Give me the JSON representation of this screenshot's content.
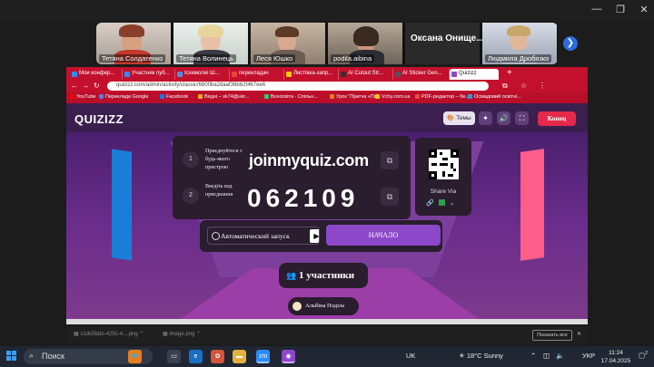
{
  "participants": [
    {
      "name": "Тетяна Солдатенко",
      "active": false
    },
    {
      "name": "Тетяна Волинець",
      "active": true
    },
    {
      "name": "Леся Юшко",
      "active": false
    },
    {
      "name": "podila.aibina",
      "active": false
    },
    {
      "name": "Оксана Онищенко",
      "display": "Оксана Онище..."
    },
    {
      "name": "Людмила Дробязко",
      "active": false
    }
  ],
  "browser": {
    "tabs": [
      "Мои конфер...",
      "Участник пуб...",
      "Ісхемолеі Ш...",
      "перекладач",
      "Листівка-запр...",
      "AI Cutout Str...",
      "AI Sticker Gen...",
      "Quizizz"
    ],
    "url": "quizizz.com/admin/activity/classic/6800ba2daaf36b62f467ee6",
    "bookmarks": [
      "YouTube",
      "Переклади Google",
      "Facebook",
      "Ведні – vk74@ukr...",
      "Всеосвіта - Спільн...",
      "Урок \"Пригча «По...",
      "Vchy.com.ua",
      "PDF-редактор – бе...",
      "Осмадовий освітні..."
    ]
  },
  "quizizz": {
    "logo": "QUIZIZZ",
    "theme_label": "Темы",
    "end_label": "Конец",
    "step1": {
      "num": "1",
      "label": "Приєднуйтеся з будь-якого пристрою",
      "value": "joinmyquiz.com"
    },
    "step2": {
      "num": "2",
      "label": "Введіть код приєднання",
      "value": "062109"
    },
    "share_label": "Share Via",
    "auto_label": "Автоматический запуск",
    "start_label": "НАЧАЛО",
    "participants_count": "1 участники",
    "player_name": "Альбіна Подiла"
  },
  "downloads": {
    "items": [
      "v1do5bdo-429c-4....png",
      "image.png"
    ],
    "show_all": "Показать все"
  },
  "taskbar": {
    "search_placeholder": "Поиск",
    "ime": "UK",
    "weather": "18°C  Sunny",
    "lang": "УКР",
    "time": "11:24",
    "date": "17.04.2025",
    "notif_count": "2"
  },
  "colors": {
    "accent": "#c2102d",
    "start": "#8c48c9",
    "end": "#e5294b"
  }
}
